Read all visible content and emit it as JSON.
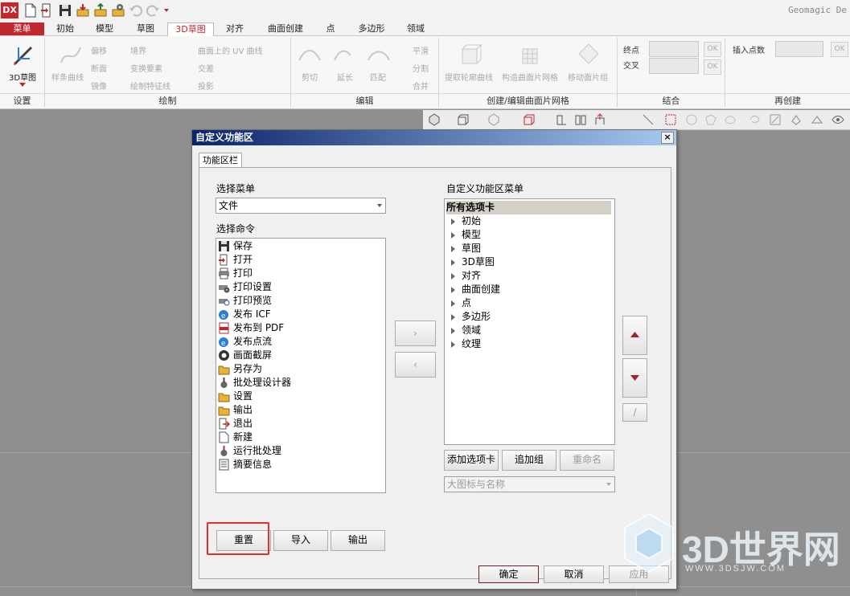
{
  "app": {
    "logo": "DX",
    "title": "Geomagic De"
  },
  "tabs": [
    "菜单",
    "初始",
    "模型",
    "草图",
    "3D草图",
    "对齐",
    "曲面创建",
    "点",
    "多边形",
    "领域"
  ],
  "ribbon": {
    "big_button": "3D草图",
    "groups": {
      "settings": "设置",
      "draw": "绘制",
      "edit": "编辑",
      "create_edit": "创建/编辑曲面片网格",
      "combine": "结合",
      "recreate": "再创建"
    },
    "draw_items": {
      "spline": "样条曲线",
      "offset": "偏移",
      "section": "断面",
      "mirror": "镜像",
      "boundary": "境界",
      "convert": "变换要素",
      "draw_feature": "绘制特征线",
      "surface_uv": "曲面上的 UV 曲线",
      "intersect": "交差",
      "project": "投影"
    },
    "edit_items": {
      "trim": "剪切",
      "extend": "延长",
      "match": "匹配",
      "smooth": "平滑",
      "split": "分割",
      "merge": "合并"
    },
    "patch_items": {
      "extract": "提取轮廓曲线",
      "build": "构造曲面片网格",
      "move": "移动面片组"
    },
    "combine": {
      "endpoint": "终点",
      "intersect": "交叉",
      "ok": "OK"
    },
    "recreate": {
      "insert_points": "插入点数",
      "ok": "OK"
    }
  },
  "dialog": {
    "title": "自定义功能区",
    "close": "×",
    "tab": "功能区栏",
    "left": {
      "select_menu_label": "选择菜单",
      "select_menu_value": "文件",
      "select_command_label": "选择命令",
      "commands": [
        "保存",
        "打开",
        "打印",
        "打印设置",
        "打印预览",
        "发布 ICF",
        "发布到 PDF",
        "发布点流",
        "画面截屏",
        "另存为",
        "批处理设计器",
        "设置",
        "输出",
        "退出",
        "新建",
        "运行批处理",
        "摘要信息"
      ]
    },
    "right": {
      "label": "自定义功能区菜单",
      "root": "所有选项卡",
      "tabs": [
        "初始",
        "模型",
        "草图",
        "3D草图",
        "对齐",
        "曲面创建",
        "点",
        "多边形",
        "领域",
        "纹理"
      ],
      "add_tab": "添加选项卡",
      "add_group": "追加组",
      "rename": "重命名",
      "display": "大图标与名称"
    },
    "move_right": "›",
    "move_left": "‹",
    "rename_small": "/",
    "reset": "重置",
    "import": "导入",
    "export": "输出",
    "ok": "确定",
    "cancel": "取消",
    "apply": "应用"
  },
  "watermark": {
    "text": "3D世界网",
    "url": "WWW.3DSJW.COM"
  },
  "colors": {
    "accent": "#c0272f",
    "highlight_box": "#e03030",
    "title_bar": "#0a246a"
  }
}
